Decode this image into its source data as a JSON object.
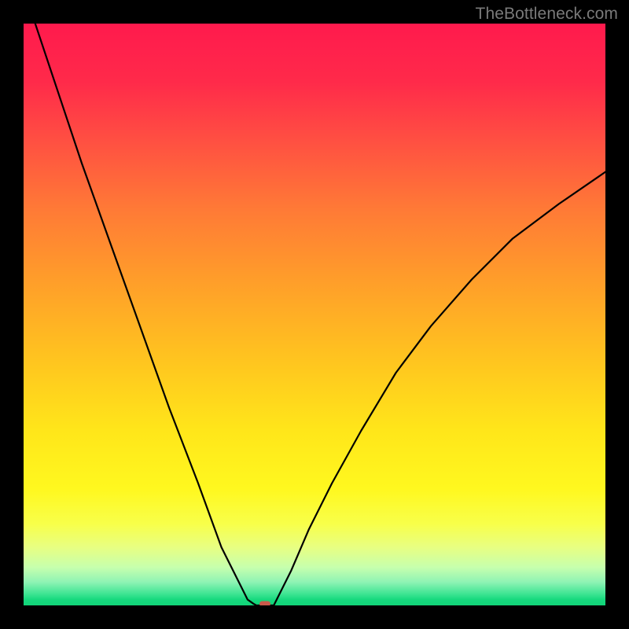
{
  "attribution": "TheBottleneck.com",
  "chart_data": {
    "type": "line",
    "title": "",
    "xlabel": "",
    "ylabel": "",
    "xlim": [
      0,
      1
    ],
    "ylim": [
      0,
      1
    ],
    "series": [
      {
        "name": "bottleneck-curve",
        "x": [
          0.0,
          0.05,
          0.1,
          0.15,
          0.2,
          0.25,
          0.3,
          0.34,
          0.37,
          0.385,
          0.395,
          0.4
        ],
        "values": [
          1.06,
          0.91,
          0.76,
          0.62,
          0.48,
          0.34,
          0.21,
          0.1,
          0.04,
          0.01,
          0.003,
          0.0
        ]
      },
      {
        "name": "flat-segment",
        "x": [
          0.4,
          0.43
        ],
        "values": [
          0.0,
          0.0
        ]
      },
      {
        "name": "bottleneck-curve-right",
        "x": [
          0.43,
          0.46,
          0.49,
          0.53,
          0.58,
          0.64,
          0.7,
          0.77,
          0.84,
          0.92,
          1.0
        ],
        "values": [
          0.0,
          0.06,
          0.13,
          0.21,
          0.3,
          0.4,
          0.48,
          0.56,
          0.63,
          0.69,
          0.745
        ]
      }
    ],
    "annotations": [
      {
        "name": "optimal-marker",
        "x": 0.415,
        "y": 0.0,
        "color": "#c95a4b"
      }
    ],
    "background": "heatmap-gradient",
    "gradient_stops": [
      {
        "pos": 0.0,
        "color": "#ff1a4d"
      },
      {
        "pos": 0.32,
        "color": "#ff7a36"
      },
      {
        "pos": 0.58,
        "color": "#ffc51f"
      },
      {
        "pos": 0.8,
        "color": "#fff81f"
      },
      {
        "pos": 0.93,
        "color": "#c6ffae"
      },
      {
        "pos": 1.0,
        "color": "#11d478"
      }
    ]
  }
}
